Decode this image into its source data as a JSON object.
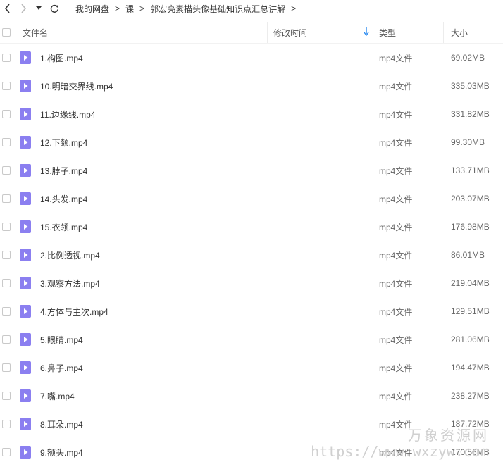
{
  "toolbar": {
    "breadcrumbs": [
      "我的网盘",
      "课",
      "郭宏亮素描头像基础知识点汇总讲解"
    ],
    "separator": ">"
  },
  "columns": {
    "name": "文件名",
    "mtime": "修改时间",
    "type": "类型",
    "size": "大小"
  },
  "files": [
    {
      "name": "1.构图.mp4",
      "type": "mp4文件",
      "size": "69.02MB"
    },
    {
      "name": "10.明暗交界线.mp4",
      "type": "mp4文件",
      "size": "335.03MB"
    },
    {
      "name": "11.边缘线.mp4",
      "type": "mp4文件",
      "size": "331.82MB"
    },
    {
      "name": "12.下颏.mp4",
      "type": "mp4文件",
      "size": "99.30MB"
    },
    {
      "name": "13.脖子.mp4",
      "type": "mp4文件",
      "size": "133.71MB"
    },
    {
      "name": "14.头发.mp4",
      "type": "mp4文件",
      "size": "203.07MB"
    },
    {
      "name": "15.衣领.mp4",
      "type": "mp4文件",
      "size": "176.98MB"
    },
    {
      "name": "2.比例透视.mp4",
      "type": "mp4文件",
      "size": "86.01MB"
    },
    {
      "name": "3.观察方法.mp4",
      "type": "mp4文件",
      "size": "219.04MB"
    },
    {
      "name": "4.方体与主次.mp4",
      "type": "mp4文件",
      "size": "129.51MB"
    },
    {
      "name": "5.眼睛.mp4",
      "type": "mp4文件",
      "size": "281.06MB"
    },
    {
      "name": "6.鼻子.mp4",
      "type": "mp4文件",
      "size": "194.47MB"
    },
    {
      "name": "7.嘴.mp4",
      "type": "mp4文件",
      "size": "238.27MB"
    },
    {
      "name": "8.耳朵.mp4",
      "type": "mp4文件",
      "size": "187.72MB"
    },
    {
      "name": "9.额头.mp4",
      "type": "mp4文件",
      "size": "170.56MB"
    }
  ],
  "watermark": {
    "title": "万象资源网",
    "url": "https://www.wxzyw.com"
  },
  "colors": {
    "file_icon": "#8b7ff0",
    "sort_arrow": "#2d8cf0",
    "checkbox_border": "#c9c9c9"
  }
}
